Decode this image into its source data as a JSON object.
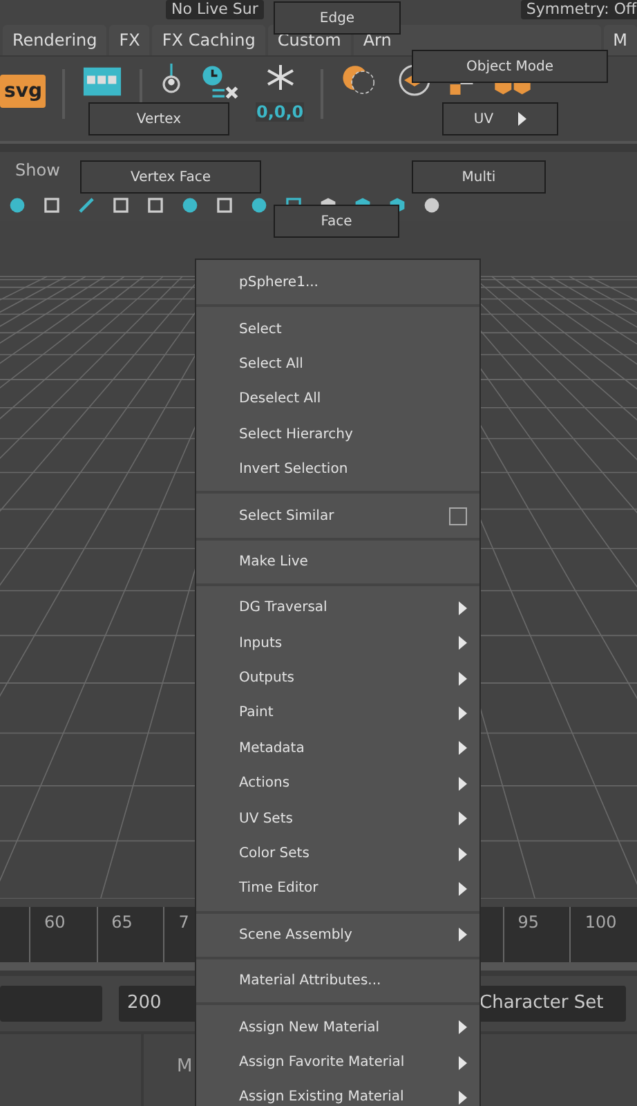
{
  "status_line": {
    "live_surface": "No Live Sur",
    "symmetry": "Symmetry: Off"
  },
  "shelf_tabs": [
    {
      "label": "Rendering",
      "selected": false
    },
    {
      "label": "FX",
      "selected": false
    },
    {
      "label": "FX Caching",
      "selected": false
    },
    {
      "label": "Custom",
      "selected": false
    },
    {
      "label": "Arn",
      "selected": false
    },
    {
      "label": "M",
      "selected": false
    }
  ],
  "shelf": {
    "svg_label": "svg",
    "freeze_label": "0,0,0"
  },
  "panel_menu": [
    "Show"
  ],
  "timeline": {
    "ticks": [
      "60",
      "65",
      "7",
      "95",
      "100"
    ]
  },
  "range": {
    "end_field": "200",
    "character_set": "Character Set"
  },
  "command_line": {
    "label": "M"
  },
  "marking_menu": [
    {
      "label": "Edge",
      "submenu": false
    },
    {
      "label": "Object Mode",
      "submenu": false
    },
    {
      "label": "Vertex",
      "submenu": false
    },
    {
      "label": "UV",
      "submenu": true
    },
    {
      "label": "Vertex Face",
      "submenu": false
    },
    {
      "label": "Multi",
      "submenu": false
    },
    {
      "label": "Face",
      "submenu": false
    }
  ],
  "context_menu": [
    {
      "kind": "item",
      "label": "pSphere1..."
    },
    {
      "kind": "separator"
    },
    {
      "kind": "item",
      "label": "Select"
    },
    {
      "kind": "item",
      "label": "Select All"
    },
    {
      "kind": "item",
      "label": "Deselect All"
    },
    {
      "kind": "item",
      "label": "Select Hierarchy"
    },
    {
      "kind": "item",
      "label": "Invert Selection"
    },
    {
      "kind": "separator"
    },
    {
      "kind": "checkbox",
      "label": "Select Similar",
      "checked": false
    },
    {
      "kind": "separator"
    },
    {
      "kind": "item",
      "label": "Make Live"
    },
    {
      "kind": "separator"
    },
    {
      "kind": "submenu",
      "label": "DG Traversal"
    },
    {
      "kind": "submenu",
      "label": "Inputs"
    },
    {
      "kind": "submenu",
      "label": "Outputs"
    },
    {
      "kind": "submenu",
      "label": "Paint"
    },
    {
      "kind": "submenu",
      "label": "Metadata"
    },
    {
      "kind": "submenu",
      "label": "Actions"
    },
    {
      "kind": "submenu",
      "label": "UV Sets"
    },
    {
      "kind": "submenu",
      "label": "Color Sets"
    },
    {
      "kind": "submenu",
      "label": "Time Editor"
    },
    {
      "kind": "separator"
    },
    {
      "kind": "submenu",
      "label": "Scene Assembly"
    },
    {
      "kind": "separator"
    },
    {
      "kind": "item",
      "label": "Material Attributes..."
    },
    {
      "kind": "separator"
    },
    {
      "kind": "submenu",
      "label": "Assign New Material"
    },
    {
      "kind": "submenu",
      "label": "Assign Favorite Material"
    },
    {
      "kind": "submenu",
      "label": "Assign Existing Material"
    }
  ]
}
